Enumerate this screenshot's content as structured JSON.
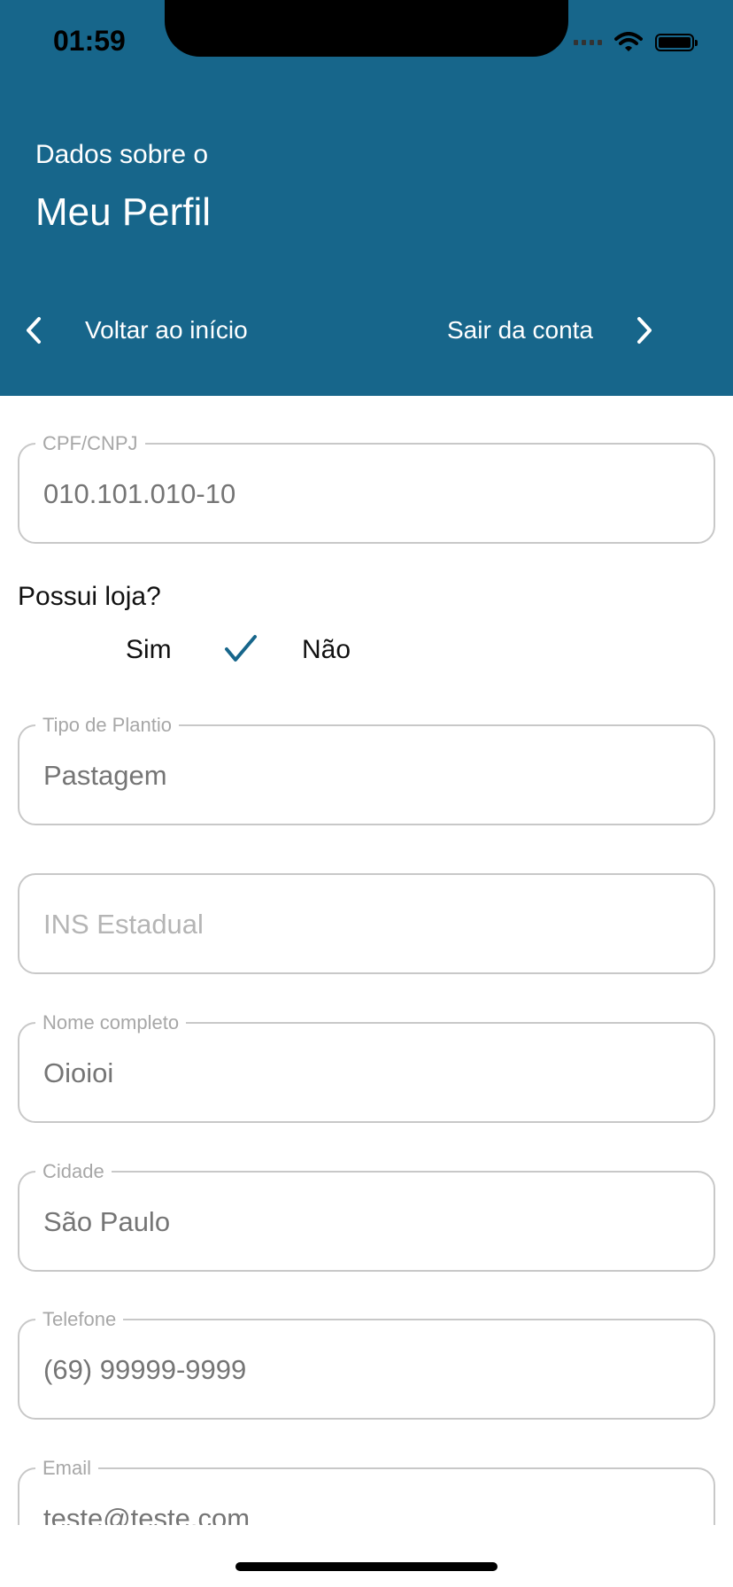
{
  "status_bar": {
    "time": "01:59"
  },
  "header": {
    "subtitle": "Dados sobre o",
    "title": "Meu Perfil",
    "back_label": "Voltar ao início",
    "exit_label": "Sair da conta",
    "background_color": "#17668b"
  },
  "form": {
    "cpf": {
      "label": "CPF/CNPJ",
      "value": "010.101.010-10"
    },
    "store_question": "Possui loja?",
    "store_options": {
      "yes": "Sim",
      "no": "Não",
      "selected": "Sim"
    },
    "plantio": {
      "label": "Tipo de Plantio",
      "value": "Pastagem"
    },
    "ins_estadual": {
      "placeholder": "INS Estadual"
    },
    "nome": {
      "label": "Nome completo",
      "value": "Oioioi"
    },
    "cidade": {
      "label": "Cidade",
      "value": "São Paulo"
    },
    "telefone": {
      "label": "Telefone",
      "value": "(69) 99999-9999"
    },
    "email": {
      "label": "Email",
      "value": "teste@teste.com"
    }
  }
}
